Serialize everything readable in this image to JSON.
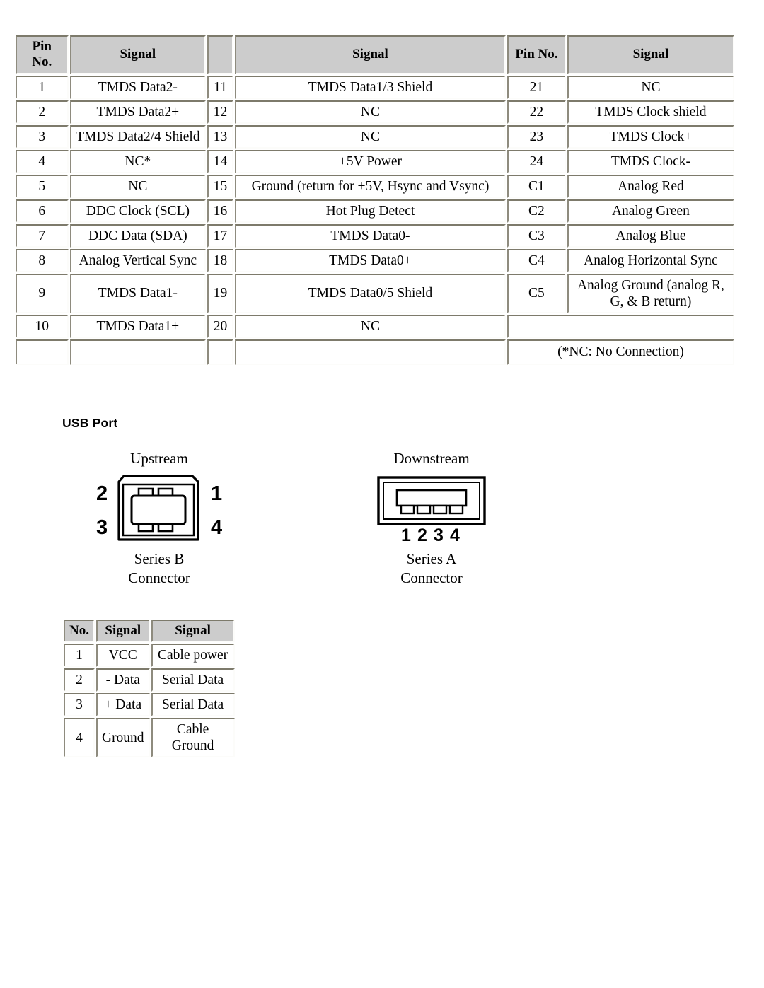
{
  "dvi_table": {
    "headers": {
      "pin_no_left": "Pin No.",
      "signal_left": "Signal",
      "pin_no_mid": "",
      "signal_mid": "Signal",
      "pin_no_right": "Pin No.",
      "signal_right": "Signal"
    },
    "rows": [
      {
        "pin_l": "1",
        "sig_l": "TMDS Data2-",
        "pin_m": "11",
        "sig_m": "TMDS Data1/3 Shield",
        "pin_r": "21",
        "sig_r": "NC"
      },
      {
        "pin_l": "2",
        "sig_l": "TMDS Data2+",
        "pin_m": "12",
        "sig_m": "NC",
        "pin_r": "22",
        "sig_r": "TMDS Clock shield"
      },
      {
        "pin_l": "3",
        "sig_l": "TMDS Data2/4 Shield",
        "pin_m": "13",
        "sig_m": "NC",
        "pin_r": "23",
        "sig_r": "TMDS Clock+"
      },
      {
        "pin_l": "4",
        "sig_l": "NC*",
        "pin_m": "14",
        "sig_m": "+5V Power",
        "pin_r": "24",
        "sig_r": "TMDS Clock-"
      },
      {
        "pin_l": "5",
        "sig_l": "NC",
        "pin_m": "15",
        "sig_m": "Ground (return for +5V, Hsync and Vsync)",
        "pin_r": "C1",
        "sig_r": "Analog Red"
      },
      {
        "pin_l": "6",
        "sig_l": "DDC Clock (SCL)",
        "pin_m": "16",
        "sig_m": "Hot Plug Detect",
        "pin_r": "C2",
        "sig_r": "Analog Green"
      },
      {
        "pin_l": "7",
        "sig_l": "DDC Data (SDA)",
        "pin_m": "17",
        "sig_m": "TMDS Data0-",
        "pin_r": "C3",
        "sig_r": "Analog Blue"
      },
      {
        "pin_l": "8",
        "sig_l": "Analog Vertical Sync",
        "pin_m": "18",
        "sig_m": "TMDS Data0+",
        "pin_r": "C4",
        "sig_r": "Analog Horizontal Sync"
      },
      {
        "pin_l": "9",
        "sig_l": "TMDS Data1-",
        "pin_m": "19",
        "sig_m": "TMDS Data0/5 Shield",
        "pin_r": "C5",
        "sig_r": "Analog Ground (analog R, G, & B return)"
      },
      {
        "pin_l": "10",
        "sig_l": "TMDS Data1+",
        "pin_m": "20",
        "sig_m": "NC",
        "pin_r": "",
        "sig_r": ""
      }
    ],
    "footnote": "(*NC: No Connection)"
  },
  "usb_section": {
    "heading": "USB Port",
    "upstream": {
      "title": "Upstream",
      "caption_line1": "Series B",
      "caption_line2": "Connector",
      "pin_labels": {
        "top_left": "2",
        "top_right": "1",
        "bottom_left": "3",
        "bottom_right": "4"
      }
    },
    "downstream": {
      "title": "Downstream",
      "caption_line1": "Series A",
      "caption_line2": "Connector",
      "pin_labels": [
        "1",
        "2",
        "3",
        "4"
      ]
    },
    "table": {
      "headers": {
        "no": "No.",
        "signal1": "Signal",
        "signal2": "Signal"
      },
      "rows": [
        {
          "no": "1",
          "signal1": "VCC",
          "signal2": "Cable power"
        },
        {
          "no": "2",
          "signal1": "- Data",
          "signal2": "Serial Data"
        },
        {
          "no": "3",
          "signal1": "+ Data",
          "signal2": "Serial Data"
        },
        {
          "no": "4",
          "signal1": "Ground",
          "signal2": "Cable Ground"
        }
      ]
    }
  },
  "colors": {
    "header_bg": "#cccccc",
    "border_dark": "#7d7a6b",
    "border_light": "#fcfcfa",
    "text": "#000000",
    "page_bg": "#ffffff"
  }
}
